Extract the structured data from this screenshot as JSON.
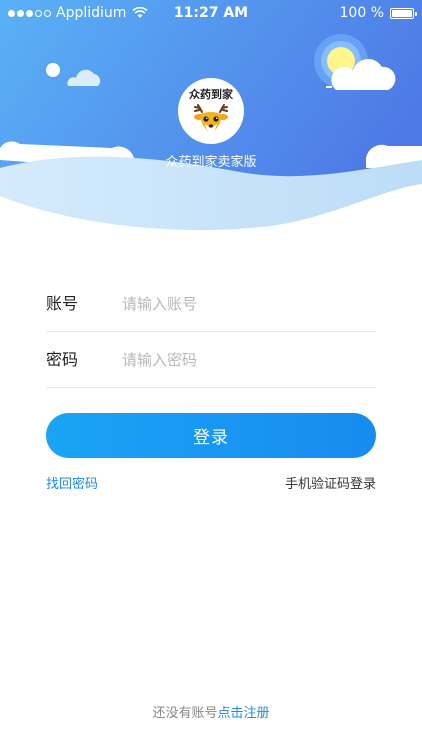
{
  "status_bar": {
    "carrier": "Applidium",
    "time": "11:27 AM",
    "battery": "100 %"
  },
  "app": {
    "logo_text": "众药到家",
    "name": "众药到家卖家版"
  },
  "form": {
    "account_label": "账号",
    "account_placeholder": "请输入账号",
    "account_value": "",
    "password_label": "密码",
    "password_placeholder": "请输入密码",
    "password_value": "",
    "login_button": "登录"
  },
  "links": {
    "forgot_password": "找回密码",
    "sms_login": "手机验证码登录"
  },
  "footer": {
    "prompt": "还没有账号",
    "register": "点击注册"
  },
  "colors": {
    "accent": "#1a8ce8",
    "header_gradient_start": "#5aa8f5",
    "header_gradient_end": "#4f7ee8"
  }
}
